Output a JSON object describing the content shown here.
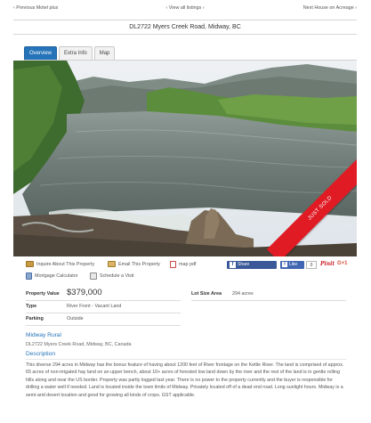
{
  "nav": {
    "prev": "‹ Previous Motel plus",
    "all": "‹ View all listings ›",
    "next": "Next House on Acreage ›"
  },
  "page_title": "DL2722 Myers Creek Road, Midway, BC",
  "tabs": [
    {
      "label": "Overview",
      "active": true
    },
    {
      "label": "Extra Info",
      "active": false
    },
    {
      "label": "Map",
      "active": false
    }
  ],
  "photo": {
    "ribbon": "JUST SOLD"
  },
  "actions": {
    "inquire": "Inquire About This Property",
    "email": "Email This Property",
    "map_pdf": "map pdf",
    "mortgage": "Mortgage Calculator",
    "schedule": "Schedule a Visit"
  },
  "social": {
    "share": "Share",
    "like": "Like",
    "like_count": "0",
    "pinit": "Pinit",
    "gplus": "G+1"
  },
  "facts": {
    "property_value_label": "Property Value",
    "property_value": "$379,000",
    "type_label": "Type",
    "type_value": "River Front - Vacant Land",
    "parking_label": "Parking",
    "parking_value": "Outside",
    "lot_size_label": "Lot Size Area",
    "lot_size_value": "294 acres"
  },
  "region_title": "Midway Rural",
  "address": "DL2722 Myers Creek Road, Midway, BC, Canada",
  "description_title": "Description",
  "description": "This diverse 294 acres in Midway has the bonus feature of having about 1200 feet of River frontage on the Kettle River. The land is comprised of approx. 65 acres of non-irrigated hay land on an upper bench, about 10+ acres of forested low land down by the river and the rest of the land is in gentle rolling hills along and near the US border. Property was partly logged last year. There is no power to the property currently and the buyer is responsible for drilling a water well if needed. Land is located inside the town limits of Midway. Privately located off of a dead end road. Long sunlight hours. Midway is a semi-arid desert location and good for growing all kinds of crops. GST applicable.",
  "colors": {
    "accent": "#2573b8",
    "ribbon": "#e01b24",
    "facebook": "#3b5998"
  }
}
